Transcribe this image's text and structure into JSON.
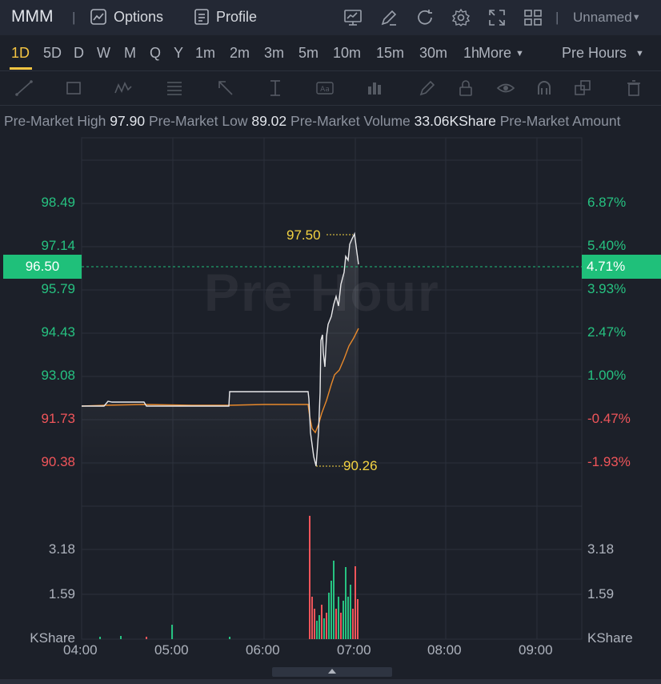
{
  "topbar": {
    "ticker": "MMM",
    "separator": "|",
    "options_label": "Options",
    "profile_label": "Profile",
    "layout_name": "Unnamed",
    "icons": [
      "options-icon",
      "profile-icon",
      "chart-settings-icon",
      "draw-icon",
      "refresh-icon",
      "gear-icon",
      "fullscreen-icon",
      "grid-layout-icon"
    ]
  },
  "timeframes": {
    "items": [
      "1D",
      "5D",
      "D",
      "W",
      "M",
      "Q",
      "Y",
      "1m",
      "2m",
      "3m",
      "5m",
      "10m",
      "15m",
      "30m",
      "1h"
    ],
    "active": "1D",
    "more_label": "More",
    "session_label": "Pre Hours"
  },
  "drawing_tools": [
    "trendline-icon",
    "rectangle-icon",
    "pattern-icon",
    "fib-icon",
    "arrow-icon",
    "measure-icon",
    "text-icon",
    "bars-icon",
    "pen-icon",
    "lock-icon",
    "eye-icon",
    "magnet-icon",
    "layers-icon",
    "trash-icon"
  ],
  "stats": {
    "high_label": "Pre-Market High",
    "high_value": "97.90",
    "low_label": "Pre-Market Low",
    "low_value": "89.02",
    "volume_label": "Pre-Market Volume",
    "volume_value": "33.06KShare",
    "amount_label": "Pre-Market Amount"
  },
  "chart": {
    "watermark": "Pre Hour",
    "current_price": "96.50",
    "current_pct": "4.71%",
    "max_annotation": "97.50",
    "min_annotation": "90.26",
    "price_labels": [
      {
        "left": "98.49",
        "right": "6.87%",
        "color": "green"
      },
      {
        "left": "97.14",
        "right": "5.40%",
        "color": "green"
      },
      {
        "left": "95.79",
        "right": "3.93%",
        "color": "green"
      },
      {
        "left": "94.43",
        "right": "2.47%",
        "color": "green"
      },
      {
        "left": "93.08",
        "right": "1.00%",
        "color": "green"
      },
      {
        "left": "91.73",
        "right": "-0.47%",
        "color": "red"
      },
      {
        "left": "90.38",
        "right": "-1.93%",
        "color": "red"
      }
    ],
    "volume_labels": {
      "v1": "3.18",
      "v2": "1.59",
      "unit": "KShare"
    },
    "x_labels": [
      "04:00",
      "05:00",
      "06:00",
      "07:00",
      "08:00",
      "09:00"
    ]
  },
  "colors": {
    "accent": "#f5c542",
    "up": "#26c281",
    "down": "#f0555a",
    "price_line": "#e8e8ea",
    "avg_line": "#e8892b"
  }
}
